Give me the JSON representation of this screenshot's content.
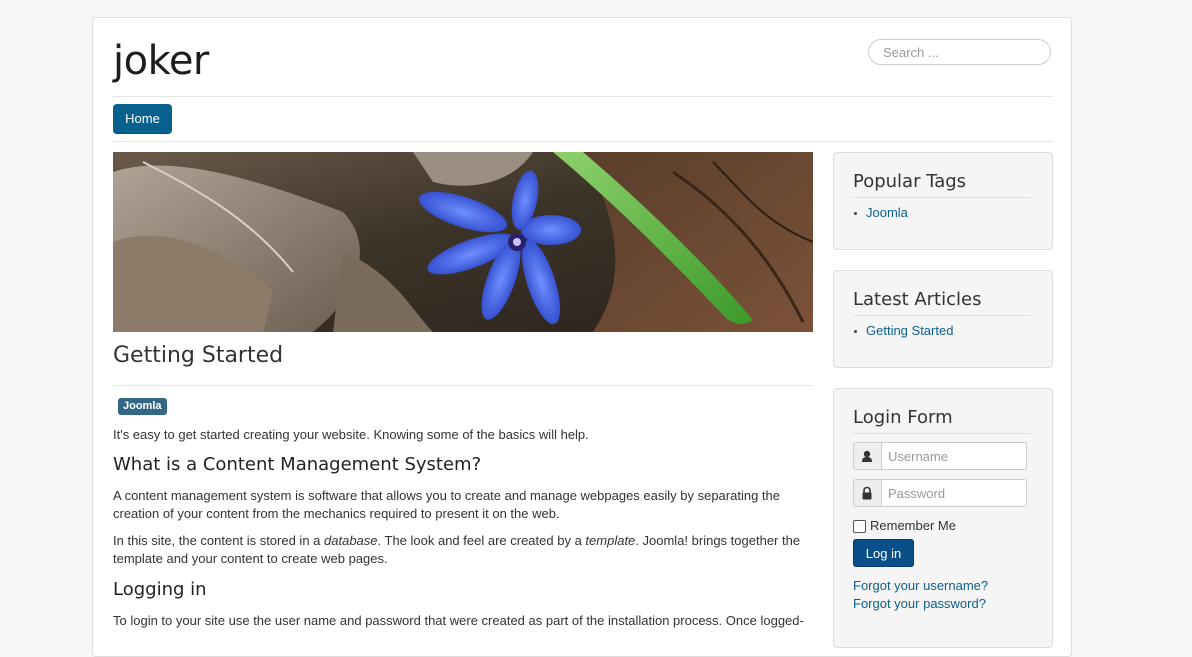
{
  "header": {
    "site_title": "joker",
    "search_placeholder": "Search ..."
  },
  "nav": {
    "home_label": "Home"
  },
  "colors": {
    "accent": "#08608c",
    "link": "#0c5e8c",
    "tag": "#346786",
    "login_button": "#0b4f8a"
  },
  "main": {
    "hero_image": "blue flower among dry leaves",
    "article_title": "Getting Started",
    "tag": "Joomla",
    "intro": "It's easy to get started creating your website. Knowing some of the basics will help.",
    "h_cms": "What is a Content Management System?",
    "cms_p": "A content management system is software that allows you to create and manage webpages easily by separating the creation of your content from the mechanics required to present it on the web.",
    "site_p_1": "In this site, the content is stored in a ",
    "site_p_em1": "database",
    "site_p_2": ". The look and feel are created by a ",
    "site_p_em2": "template",
    "site_p_3": ". Joomla! brings together the template and your content to create web pages.",
    "h_login": "Logging in",
    "login_p": "To login to your site use the user name and password that were created as part of the installation process. Once logged-"
  },
  "sidebar": {
    "popular_tags": {
      "title": "Popular Tags",
      "items": [
        "Joomla"
      ]
    },
    "latest_articles": {
      "title": "Latest Articles",
      "items": [
        "Getting Started"
      ]
    },
    "login_form": {
      "title": "Login Form",
      "username_placeholder": "Username",
      "password_placeholder": "Password",
      "user_icon": "user-icon",
      "lock_icon": "lock-icon",
      "remember_label": "Remember Me",
      "remember_checked": false,
      "login_button": "Log in",
      "forgot_username": "Forgot your username?",
      "forgot_password": "Forgot your password?"
    }
  }
}
